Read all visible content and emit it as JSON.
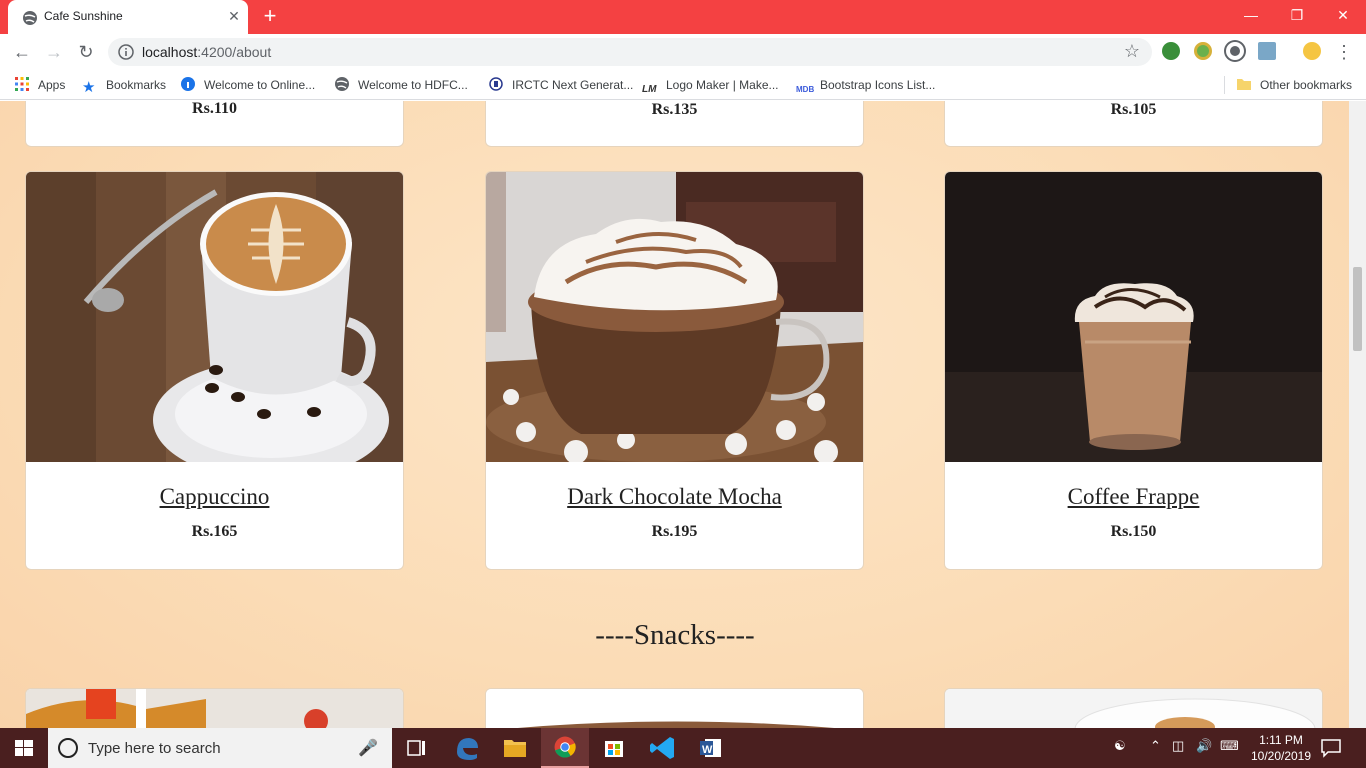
{
  "browser": {
    "tab_title": "Cafe Sunshine",
    "tab_close": "✕",
    "new_tab": "+",
    "url_host": "localhost",
    "url_path": ":4200/about",
    "window_controls": {
      "minimize": "—",
      "restore": "❐",
      "close": "✕"
    }
  },
  "bookmarks": [
    {
      "label": "Apps",
      "icon": "apps-grid-icon"
    },
    {
      "label": "Bookmarks",
      "icon": "star-icon"
    },
    {
      "label": "Welcome to Online...",
      "icon": "info-circle-icon"
    },
    {
      "label": "Welcome to HDFC...",
      "icon": "globe-icon"
    },
    {
      "label": "IRCTC Next Generat...",
      "icon": "irctc-icon"
    },
    {
      "label": "Logo Maker | Make...",
      "icon": "lm-icon"
    },
    {
      "label": "Bootstrap Icons List...",
      "icon": "mdb-icon"
    },
    {
      "label": "Other bookmarks",
      "icon": "folder-icon"
    }
  ],
  "page": {
    "top_prices": [
      "Rs.110",
      "Rs.135",
      "Rs.105"
    ],
    "products": [
      {
        "name": "Cappuccino",
        "price": "Rs.165"
      },
      {
        "name": "Dark Chocolate Mocha",
        "price": "Rs.195"
      },
      {
        "name": "Coffee Frappe",
        "price": "Rs.150"
      }
    ],
    "section_title": "----Snacks----"
  },
  "taskbar": {
    "search_placeholder": "Type here to search",
    "time": "1:11 PM",
    "date": "10/20/2019"
  },
  "colors": {
    "chrome_titlebar": "#f44142",
    "page_background": "#fbdcb6",
    "taskbar": "#4a1f1f"
  }
}
